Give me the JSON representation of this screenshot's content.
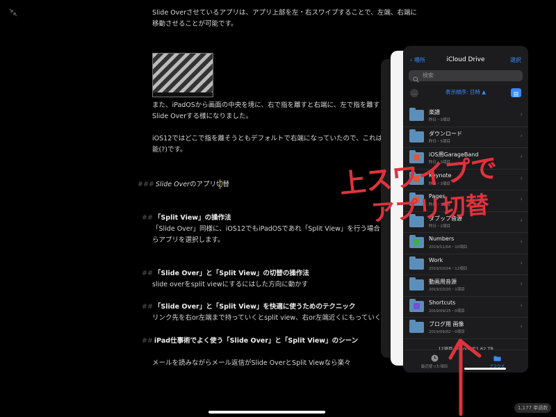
{
  "editor": {
    "para1_line1": "Slide Overさせているアプリは、アプリ上部を左・右スワイプすることで、左端、右端に",
    "para1_line2": "移動させることが可能です。",
    "para2_line1": "また、iPadOSから画面の中央を境に、右で指を離すと右端に、左で指を離すと左",
    "para2_line2": "Slide Overする様になりました。",
    "para3_line1": "iOS12ではどこで指を離そうともデフォルトで右端になっていたので、これは隠れ",
    "para3_line2": "能(?)です。",
    "h_switch_hash": "###",
    "h_switch_em": "Slide Over",
    "h_switch_rest": "のアプリ切替",
    "h_split_hash": "##",
    "h_split": "「Split View」の操作法",
    "split_line1": "「Slide Over」同様に、iOS12でもiPadOSであれ「Split View」を行う場合はD",
    "split_line2": "らアプリを選択します。",
    "h_toggle_hash": "##",
    "h_toggle": "「Slide Over」と「Split View」の切替の操作法",
    "toggle_line": "slide overをsplit viewにするにはした方向に動かす",
    "h_tech_hash": "##",
    "h_tech": "「Slide Over」と「Split View」を快適に使うためのテクニック",
    "tech_line": "リンク先を右or左端まで持っていくとsplit view、右or左端近くにもっていくとsli",
    "h_work_hash": "##",
    "h_work": "iPad仕事術でよく使う「Slide Over」と「Split View」のシーン",
    "work_line": "メールを読みながらメール返信がSlide OverとSplit Viewなら楽々"
  },
  "files": {
    "back_label": "場所",
    "title": "iCloud Drive",
    "select_label": "選択",
    "search_placeholder": "検索",
    "sort_label": "表示順序: 日時 ▲",
    "more_label": "…",
    "items": [
      {
        "name": "楽譜",
        "meta": "昨日・3項目",
        "badge": ""
      },
      {
        "name": "ダウンロード",
        "meta": "昨日・5項目",
        "badge": ""
      },
      {
        "name": "iOS用GarageBand",
        "meta": "昨日・3項目",
        "badge": "#e0573a"
      },
      {
        "name": "Keynote",
        "meta": "昨日・3項目",
        "badge": "#e0573a"
      },
      {
        "name": "Pages",
        "meta": "昨日・3項目",
        "badge": "#e0573a"
      },
      {
        "name": "ダブップ音源",
        "meta": "昨日・2項目",
        "badge": ""
      },
      {
        "name": "Numbers",
        "meta": "2019/11/04・10項目",
        "badge": "#3fae49"
      },
      {
        "name": "Work",
        "meta": "2019/10/24・12項目",
        "badge": ""
      },
      {
        "name": "動画用音源",
        "meta": "2019/10/20・1項目",
        "badge": ""
      },
      {
        "name": "Shortcuts",
        "meta": "2019/09/25・0項目",
        "badge": "#7a4fd6"
      },
      {
        "name": "ブログ用 画像",
        "meta": "2019/09/02・0項目",
        "badge": ""
      }
    ],
    "footer_info": "12項目、iCloudで1.62 TB",
    "tab_recent": "最近使った項目",
    "tab_browse": "ブラウズ"
  },
  "annotation": {
    "line1": "上スワイプで",
    "line2": "アプリ切替",
    "color": "#e0323c"
  },
  "status": {
    "word_count": "1,177 単語数"
  }
}
